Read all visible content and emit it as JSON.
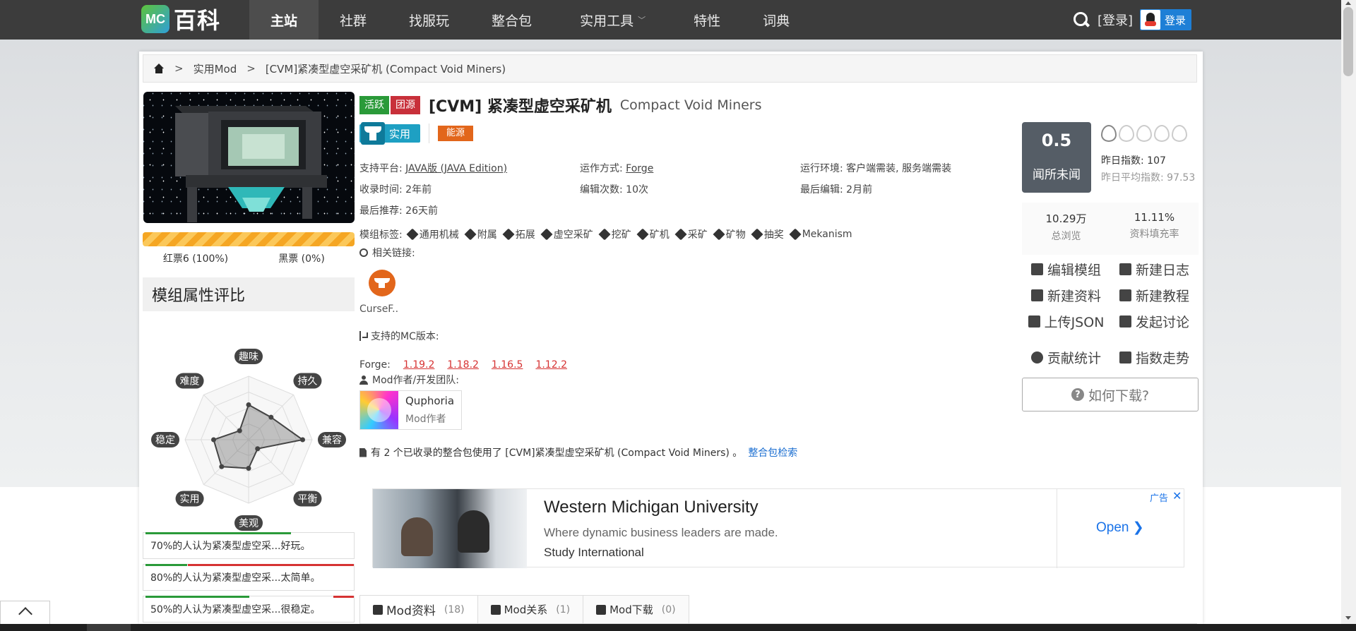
{
  "nav": {
    "logo_badge": "MC",
    "logo_text": "百科",
    "items": [
      {
        "label": "主站",
        "active": true
      },
      {
        "label": "社群"
      },
      {
        "label": "找服玩"
      },
      {
        "label": "整合包"
      },
      {
        "label": "实用工具",
        "dropdown": true
      },
      {
        "label": "特性"
      },
      {
        "label": "词典"
      }
    ],
    "login_link": "[登录]",
    "qq_login": "登录"
  },
  "breadcrumb": {
    "category": "实用Mod",
    "current": "[CVM]紧凑型虚空采矿机 (Compact Void Miners)"
  },
  "mod": {
    "status_tags": [
      "活跃",
      "团源"
    ],
    "title_cn": "[CVM] 紧凑型虚空采矿机",
    "title_en": "Compact Void Miners",
    "category": "实用",
    "subcategory": "能源",
    "info": [
      [
        {
          "label": "支持平台: ",
          "value": "JAVA版 (JAVA Edition)"
        },
        {
          "label": "运作方式: ",
          "value": "Forge"
        },
        {
          "label": "运行环境: ",
          "value": "客户端需装, 服务端需装"
        }
      ],
      [
        {
          "label": "收录时间: ",
          "value": "2年前"
        },
        {
          "label": "编辑次数: ",
          "value": "10次"
        },
        {
          "label": "最后编辑: ",
          "value": "2月前"
        }
      ],
      [
        {
          "label": "最后推荐: ",
          "value": "26天前"
        }
      ]
    ],
    "tags_label": "模组标签:",
    "tags": [
      "通用机械",
      "附属",
      "拓展",
      "虚空采矿",
      "挖矿",
      "矿机",
      "采矿",
      "矿物",
      "抽奖",
      "Mekanism"
    ],
    "links_label": "相关链接:",
    "link_name": "CurseF..",
    "versions_label": "支持的MC版本:",
    "loader": "Forge:",
    "versions": [
      "1.19.2",
      "1.18.2",
      "1.16.5",
      "1.12.2"
    ],
    "authors_label": "Mod作者/开发团队:",
    "author": {
      "name": "Quphoria",
      "role": "Mod作者"
    },
    "modpack_text": "有 2 个已收录的整合包使用了 [CVM]紧凑型虚空采矿机 (Compact Void Miners) 。",
    "modpack_link": "整合包检索"
  },
  "votes": {
    "red": "红票6 (100%)",
    "black": "黑票 (0%)",
    "red_fraction": 1.0
  },
  "attributes": {
    "heading": "模组属性评比",
    "axes": [
      "趣味",
      "持久",
      "兼容",
      "平衡",
      "美观",
      "实用",
      "稳定",
      "难度"
    ],
    "values": [
      0.55,
      0.5,
      0.85,
      0.2,
      0.45,
      0.6,
      0.55,
      0.2
    ],
    "stats": [
      {
        "text": "70%的人认为紧凑型虚空采...好玩。",
        "green": 0.7,
        "red": 0.0
      },
      {
        "text": "80%的人认为紧凑型虚空采...太简单。",
        "green": 0.2,
        "red": 0.8
      },
      {
        "text": "50%的人认为紧凑型虚空采...很稳定。",
        "green": 0.5,
        "red": 0.1
      }
    ]
  },
  "score": {
    "value": "0.5",
    "label": "闻所未闻",
    "flames_lit": 1,
    "yesterday": "昨日指数: 107",
    "yesterday_avg": "昨日平均指数: 97.53"
  },
  "stats": [
    {
      "value": "10.29万",
      "label": "总浏览"
    },
    {
      "value": "11.11%",
      "label": "资料填充率"
    }
  ],
  "actions": [
    [
      "编辑模组",
      "新建日志"
    ],
    [
      "新建资料",
      "新建教程"
    ],
    [
      "上传JSON",
      "发起讨论"
    ],
    [
      "贡献统计",
      "指数走势"
    ]
  ],
  "download_button": "如何下载?",
  "ad": {
    "title": "Western Michigan University",
    "subtitle": "Where dynamic business leaders are made.",
    "source": "Study International",
    "cta": "Open",
    "badge": "广告"
  },
  "tabs": [
    {
      "label": "Mod资料",
      "count": "(18)",
      "active": true
    },
    {
      "label": "Mod关系",
      "count": "(1)"
    },
    {
      "label": "Mod下载",
      "count": "(0)"
    }
  ],
  "colors": {
    "topnav": "#3c3c3c",
    "tag_active": "#2a9a39",
    "tag_source": "#c8303a",
    "category": "#1ea0c3",
    "subcategory": "#e2661b",
    "version_link": "#d63333",
    "link": "#1c6fd1"
  }
}
